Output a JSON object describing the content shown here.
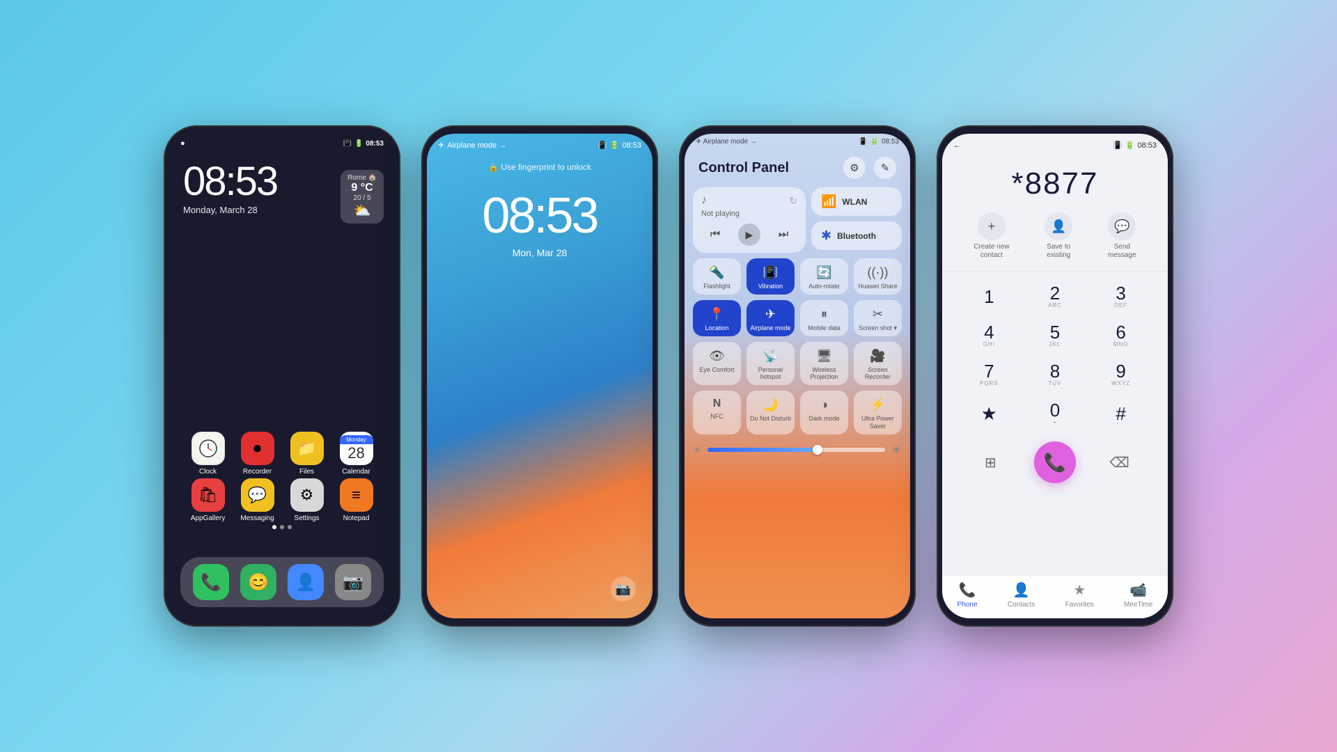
{
  "phone1": {
    "status": {
      "left": "●",
      "time": "08:53"
    },
    "time": "08:53",
    "date": "Monday, March 28",
    "weather": {
      "icon": "⛅",
      "temp": "9 °C",
      "range": "20 / 5",
      "city": "Rome 🏠"
    },
    "apps": [
      {
        "name": "Clock",
        "icon": "✂",
        "bg": "#f5f5f0",
        "label": "Clock"
      },
      {
        "name": "Recorder",
        "icon": "⏺",
        "bg": "#e03030",
        "label": "Recorder"
      },
      {
        "name": "Files",
        "icon": "📁",
        "bg": "#f0c020",
        "label": "Files"
      },
      {
        "name": "Calendar",
        "icon": "28",
        "bg": "#f5f5ff",
        "label": "Calendar"
      }
    ],
    "apps2": [
      {
        "name": "AppGallery",
        "icon": "🛍",
        "bg": "#e84040",
        "label": "AppGallery"
      },
      {
        "name": "Messaging",
        "icon": "💬",
        "bg": "#f0c020",
        "label": "Messaging"
      },
      {
        "name": "Settings",
        "icon": "⚙",
        "bg": "#e0e0e0",
        "label": "Settings"
      },
      {
        "name": "Notepad",
        "icon": "≡",
        "bg": "#f07820",
        "label": "Notepad"
      }
    ],
    "dock": [
      {
        "name": "Phone",
        "icon": "📞",
        "bg": "#30c060"
      },
      {
        "name": "FaceTime",
        "icon": "😊",
        "bg": "#30b060"
      },
      {
        "name": "Contacts",
        "icon": "👤",
        "bg": "#4488ff"
      },
      {
        "name": "Camera",
        "icon": "📷",
        "bg": "#888"
      }
    ]
  },
  "phone2": {
    "airplane": "Airplane mode →",
    "time": "08:53",
    "date": "Mon, Mar 28",
    "fingerprint": "🔒 Use fingerprint to unlock",
    "status_time": "08:53"
  },
  "phone3": {
    "airplane": "Airplane mode →",
    "status_time": "08:53",
    "title": "Control Panel",
    "media": {
      "label": "Not playing",
      "prev": "⏮",
      "play": "▶",
      "next": "⏭"
    },
    "wlan": "WLAN",
    "bluetooth": "Bluetooth",
    "toggles": [
      {
        "id": "flashlight",
        "icon": "🔦",
        "label": "Flashlight",
        "active": false
      },
      {
        "id": "vibration",
        "icon": "📳",
        "label": "Vibration",
        "active": true
      },
      {
        "id": "autorotate",
        "icon": "🔄",
        "label": "Auto-rotate",
        "active": false
      },
      {
        "id": "huawei-share",
        "icon": "((·))",
        "label": "Huawei\nShare",
        "active": false
      },
      {
        "id": "location",
        "icon": "📍",
        "label": "Location",
        "active": true
      },
      {
        "id": "airplane",
        "icon": "✈",
        "label": "Airplane\nmode",
        "active": true
      },
      {
        "id": "mobile-data",
        "icon": "⏸",
        "label": "Mobile data",
        "active": false
      },
      {
        "id": "screen-shot",
        "icon": "✂",
        "label": "Screen\nshot",
        "active": false
      },
      {
        "id": "eye-comfort",
        "icon": "👁",
        "label": "Eye Comfort",
        "active": false
      },
      {
        "id": "personal-hotspot",
        "icon": "📡",
        "label": "Personal\nhotspot",
        "active": false
      },
      {
        "id": "wireless-proj",
        "icon": "🖥",
        "label": "Wireless\nProjection",
        "active": false
      },
      {
        "id": "screen-recorder",
        "icon": "🎥",
        "label": "Screen\nRecorder",
        "active": false
      },
      {
        "id": "nfc",
        "icon": "N",
        "label": "NFC",
        "active": false
      },
      {
        "id": "do-not-disturb",
        "icon": "🌙",
        "label": "Do Not\nDisturb",
        "active": false
      },
      {
        "id": "dark-mode",
        "icon": "◑",
        "label": "Dark mode",
        "active": false
      },
      {
        "id": "ultra-power",
        "icon": "⚡",
        "label": "Ultra Power\nSaver",
        "active": false
      }
    ],
    "brightness": 62
  },
  "phone4": {
    "status_time": "08:53",
    "number": "*8877",
    "actions": [
      {
        "id": "create-contact",
        "icon": "+",
        "label": "Create new\ncontact"
      },
      {
        "id": "save-existing",
        "icon": "👤",
        "label": "Save to\nexisting"
      },
      {
        "id": "send-message",
        "icon": "💬",
        "label": "Send\nmessage"
      }
    ],
    "keys": [
      {
        "num": "1",
        "sub": ""
      },
      {
        "num": "2",
        "sub": "ABC"
      },
      {
        "num": "3",
        "sub": "DEF"
      },
      {
        "num": "4",
        "sub": "GHI"
      },
      {
        "num": "5",
        "sub": "JKL"
      },
      {
        "num": "6",
        "sub": "MNO"
      },
      {
        "num": "7",
        "sub": "PQRS"
      },
      {
        "num": "8",
        "sub": "TUV"
      },
      {
        "num": "9",
        "sub": "WXYZ"
      },
      {
        "num": "*",
        "sub": ""
      },
      {
        "num": "0",
        "sub": "+"
      },
      {
        "num": "#",
        "sub": ""
      }
    ],
    "nav": [
      {
        "id": "phone",
        "icon": "📞",
        "label": "Phone",
        "active": true
      },
      {
        "id": "contacts",
        "icon": "👤",
        "label": "Contacts",
        "active": false
      },
      {
        "id": "favorites",
        "icon": "★",
        "label": "Favorites",
        "active": false
      },
      {
        "id": "meetme",
        "icon": "📹",
        "label": "MeeTime",
        "active": false
      }
    ]
  }
}
